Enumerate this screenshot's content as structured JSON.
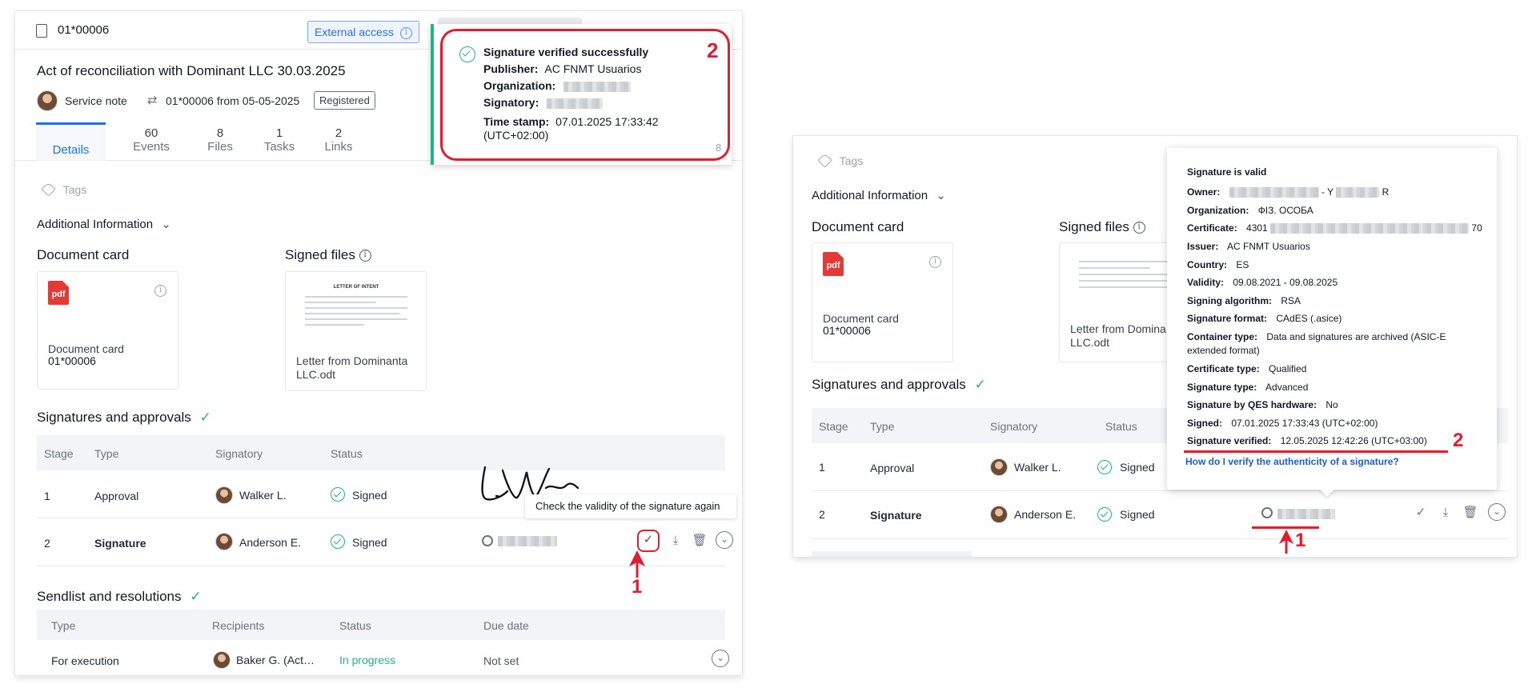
{
  "left": {
    "doc_id": "01*00006",
    "external_access": "External access",
    "title": "Act of reconciliation with Dominant LLC 30.03.2025",
    "doc_type": "Service note",
    "doc_number": "01*00006 from 05-05-2025",
    "status_badge": "Registered",
    "tabs": [
      {
        "label": "Details",
        "count": ""
      },
      {
        "label": "Events",
        "count": "60"
      },
      {
        "label": "Files",
        "count": "8"
      },
      {
        "label": "Tasks",
        "count": "1"
      },
      {
        "label": "Links",
        "count": "2"
      }
    ],
    "tags": "Tags",
    "additional_info": "Additional Information",
    "document_card_heading": "Document card",
    "signed_files_heading": "Signed files",
    "doc_card_name": "Document card",
    "doc_card_number": "01*00006",
    "signed_file_name": "Letter from Dominanta LLC.odt",
    "thumb_title": "LETTER OF INTENT",
    "pdf_label": "pdf",
    "signatures_heading": "Signatures and approvals",
    "sig_columns": [
      "Stage",
      "Type",
      "Signatory",
      "Status"
    ],
    "sig_rows": [
      {
        "stage": "1",
        "type": "Approval",
        "signatory": "Walker L.",
        "status": "Signed"
      },
      {
        "stage": "2",
        "type": "Signature",
        "signatory": "Anderson E.",
        "status": "Signed"
      }
    ],
    "tooltip": "Check the validity of the signature again",
    "sendlist_heading": "Sendlist and resolutions",
    "send_columns": [
      "Type",
      "Recipients",
      "Status",
      "Due date"
    ],
    "send_rows": [
      {
        "type": "For execution",
        "recipients": "Baker G. (Act…",
        "status": "In progress",
        "due": "Not set"
      }
    ],
    "popup": {
      "title": "Signature verified successfully",
      "publisher_label": "Publisher:",
      "publisher": "AC FNMT Usuarios",
      "organization_label": "Organization:",
      "signatory_label": "Signatory:",
      "timestamp_label": "Time stamp:",
      "timestamp": "07.01.2025 17:33:42",
      "timezone": "(UTC+02:00)",
      "corner_number": "8"
    },
    "marker_1": "1",
    "marker_2": "2"
  },
  "right": {
    "tags": "Tags",
    "additional_info": "Additional Information",
    "document_card_heading": "Document card",
    "signed_files_heading": "Signed files",
    "doc_card_name": "Document card",
    "doc_card_number": "01*00006",
    "signed_file_name": "Letter from Domina LLC.odt",
    "pdf_label": "pdf",
    "signatures_heading": "Signatures and approvals",
    "sig_columns": [
      "Stage",
      "Type",
      "Signatory",
      "Status"
    ],
    "sig_rows": [
      {
        "stage": "1",
        "type": "Approval",
        "signatory": "Walker L.",
        "status": "Signed"
      },
      {
        "stage": "2",
        "type": "Signature",
        "signatory": "Anderson E.",
        "status": "Signed"
      }
    ],
    "validity": {
      "title": "Signature is valid",
      "owner_label": "Owner:",
      "owner_mid": "- Y",
      "owner_end": "R",
      "organization_label": "Organization:",
      "organization": "ФІЗ. ОСОБА",
      "certificate_label": "Certificate:",
      "certificate_start": "4301",
      "certificate_end": "70",
      "issuer_label": "Issuer:",
      "issuer": "AC FNMT Usuarios",
      "country_label": "Country:",
      "country": "ES",
      "validity_label": "Validity:",
      "validity": "09.08.2021 - 09.08.2025",
      "algorithm_label": "Signing algorithm:",
      "algorithm": "RSA",
      "format_label": "Signature format:",
      "format": "CAdES (.asice)",
      "container_label": "Container type:",
      "container": "Data and signatures are archived (ASIC-E",
      "container_2": "extended format)",
      "cert_type_label": "Certificate type:",
      "cert_type": "Qualified",
      "sig_type_label": "Signature type:",
      "sig_type": "Advanced",
      "qes_label": "Signature by QES hardware:",
      "qes": "No",
      "signed_label": "Signed:",
      "signed": "07.01.2025 17:33:43 (UTC+02:00)",
      "verified_label": "Signature verified:",
      "verified": "12.05.2025 12:42:26 (UTC+03:00)",
      "help_link": "How do I verify the authenticity of a signature?"
    },
    "marker_1": "1",
    "marker_2": "2"
  },
  "colors": {
    "accent": "#1a73e8",
    "green": "#20b486",
    "annotation_red": "#e11d2e",
    "header_bg": "#f2f4f7"
  }
}
